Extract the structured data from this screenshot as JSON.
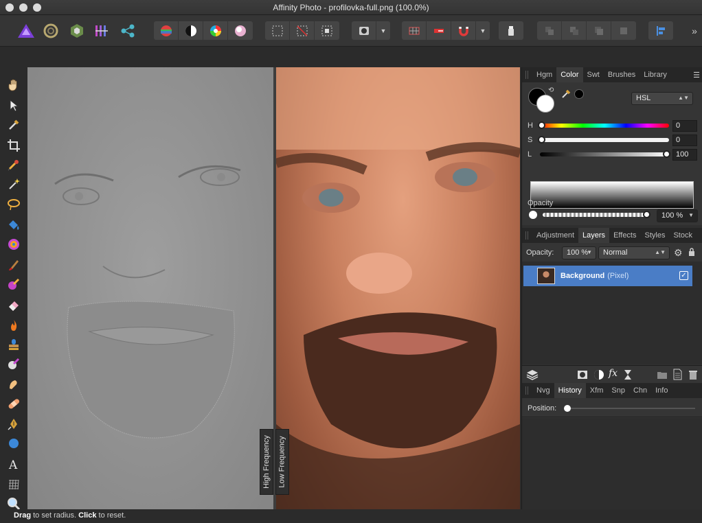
{
  "window": {
    "title": "Affinity Photo - profilovka-full.png (100.0%)"
  },
  "canvas": {
    "labels": {
      "high_frequency": "High Frequency",
      "low_frequency": "Low Frequency"
    }
  },
  "color_panel": {
    "tabs": [
      "Hgm",
      "Color",
      "Swt",
      "Brushes",
      "Library"
    ],
    "active_tab": "Color",
    "mode": "HSL",
    "h": {
      "label": "H",
      "value": "0"
    },
    "s": {
      "label": "S",
      "value": "0"
    },
    "l": {
      "label": "L",
      "value": "100"
    },
    "opacity_label": "Opacity",
    "opacity_value": "100 %"
  },
  "layers_panel": {
    "tabs": [
      "Adjustment",
      "Layers",
      "Effects",
      "Styles",
      "Stock"
    ],
    "active_tab": "Layers",
    "opacity_label": "Opacity:",
    "opacity_value": "100 %",
    "blend_mode": "Normal",
    "layer": {
      "name": "Background",
      "type": "(Pixel)",
      "checked": "✓"
    },
    "footer_fx": "fx"
  },
  "history_panel": {
    "tabs": [
      "Nvg",
      "History",
      "Xfm",
      "Snp",
      "Chn",
      "Info"
    ],
    "active_tab": "History",
    "position_label": "Position:"
  },
  "status": {
    "drag": "Drag",
    "drag_text": " to set radius. ",
    "click": "Click",
    "click_text": " to reset."
  },
  "colors": {
    "accent": "#4a7dc6",
    "hue_start": "#ff0000"
  }
}
